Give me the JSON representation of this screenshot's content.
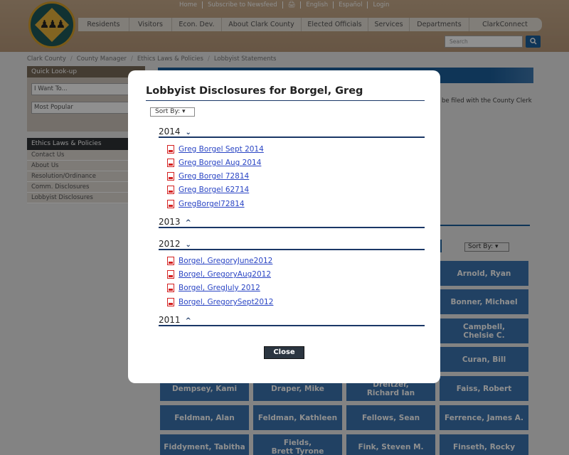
{
  "utility_nav": [
    "Home",
    "Subscribe to Newsfeed",
    "🖨",
    "English",
    "Español",
    "Login"
  ],
  "main_nav": [
    "Residents",
    "Visitors",
    "Econ. Dev.",
    "About Clark County",
    "Elected Officials",
    "Services",
    "Departments",
    "ClarkConnect"
  ],
  "search": {
    "placeholder": "Search",
    "button_icon": "search-icon"
  },
  "breadcrumb": [
    "Clark County",
    "County Manager",
    "Ethics Laws & Policies",
    "Lobbyist Statements"
  ],
  "quick_lookup": {
    "title": "Quick Look-up",
    "i_want_to": "I Want To...",
    "most_popular": "Most Popular"
  },
  "ethics": {
    "title": "Ethics Laws & Policies",
    "items": [
      "Contact Us",
      "About Us",
      "Resolution/Ordinance",
      "Comm. Disclosures",
      "Lobbyist Disclosures"
    ]
  },
  "clerk_fragment": "t be filed with the County Clerk",
  "page_sort_label": "Sort By: ▾",
  "lobbyists": [
    "Arnold, Ryan",
    "Bonner, Michael",
    "Campbell,\nChelsie C.",
    "Curan, Bill",
    "Dempsey, Kami",
    "Draper, Mike",
    "Dreitzer,\nRichard Ian",
    "Faiss, Robert",
    "Feldman, Alan",
    "Feldman, Kathleen",
    "Fellows, Sean",
    "Ferrence, James A.",
    "Fiddyment, Tabitha",
    "Fields,\nBrett Tyrone",
    "Fink, Steven M.",
    "Finseth, Rocky"
  ],
  "modal": {
    "title": "Lobbyist Disclosures for Borgel, Greg",
    "sort_label": "Sort By: ▾",
    "groups": [
      {
        "year": "2014",
        "expanded": true,
        "chevron": "⌵",
        "docs": [
          "Greg Borgel Sept 2014",
          "Greg Borgel Aug 2014",
          "Greg Borgel 72814",
          "Greg Borgel 62714",
          "GregBorgel72814"
        ]
      },
      {
        "year": "2013",
        "expanded": false,
        "chevron": "^",
        "docs": []
      },
      {
        "year": "2012",
        "expanded": true,
        "chevron": "⌵",
        "docs": [
          "Borgel, GregoryJune2012",
          "Borgel, GregoryAug2012",
          "Borgel, GregJuly 2012",
          "Borgel, GregorySept2012"
        ]
      },
      {
        "year": "2011",
        "expanded": false,
        "chevron": "^",
        "docs": []
      }
    ],
    "close_label": "Close"
  },
  "colors": {
    "accent_blue": "#1c5f9c",
    "tile_blue": "#3c75b0",
    "navy_rule": "#1a3766",
    "link": "#2a45c4"
  }
}
